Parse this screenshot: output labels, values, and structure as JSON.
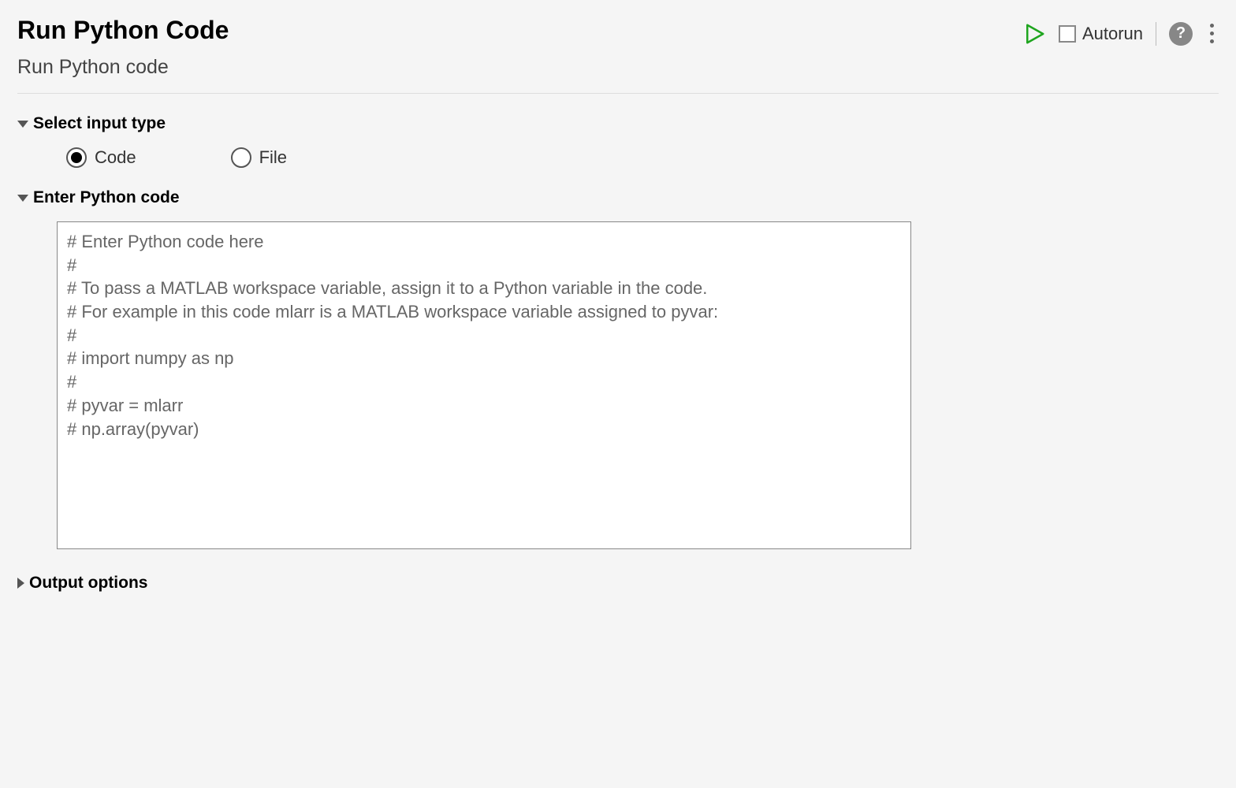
{
  "header": {
    "title": "Run Python Code",
    "subtitle": "Run Python code",
    "autorun_label": "Autorun",
    "help_symbol": "?"
  },
  "sections": {
    "input_type": {
      "label": "Select input type",
      "options": {
        "code": "Code",
        "file": "File"
      },
      "selected": "code"
    },
    "enter_code": {
      "label": "Enter Python code",
      "content": "# Enter Python code here\n#\n# To pass a MATLAB workspace variable, assign it to a Python variable in the code.\n# For example in this code mlarr is a MATLAB workspace variable assigned to pyvar:\n#\n# import numpy as np\n#\n# pyvar = mlarr\n# np.array(pyvar)"
    },
    "output_options": {
      "label": "Output options"
    }
  }
}
